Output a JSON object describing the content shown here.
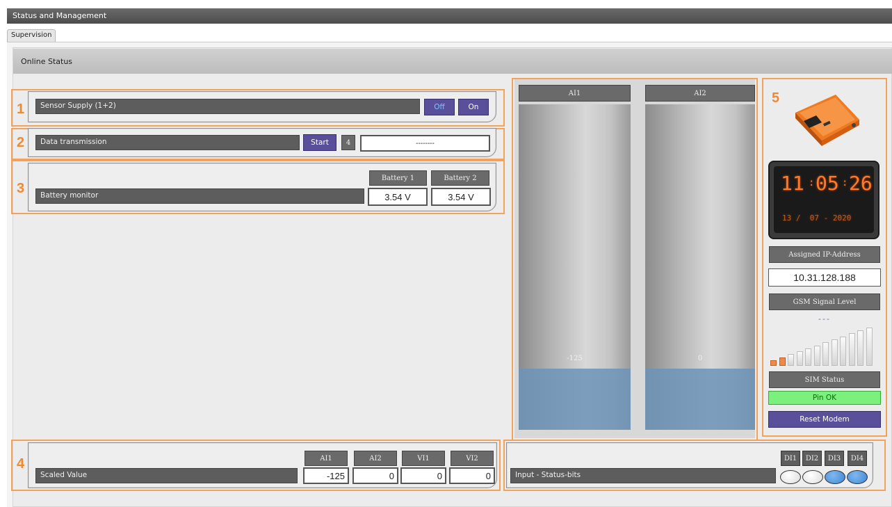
{
  "window": {
    "title": "Status and Management"
  },
  "tabs": [
    {
      "label": "Supervision"
    }
  ],
  "section": {
    "title": "Online Status"
  },
  "sensor_supply": {
    "number": "1",
    "label": "Sensor Supply (1+2)",
    "off_label": "Off",
    "on_label": "On"
  },
  "data_transmission": {
    "number": "2",
    "label": "Data transmission",
    "start_label": "Start",
    "count": "4",
    "value": "--------"
  },
  "battery_monitor": {
    "number": "3",
    "label": "Battery monitor",
    "headers": [
      "Battery 1",
      "Battery 2"
    ],
    "values": [
      "3.54 V",
      "3.54 V"
    ]
  },
  "scaled_value": {
    "number": "4",
    "label": "Scaled Value",
    "headers": [
      "AI1",
      "AI2",
      "VI1",
      "VI2"
    ],
    "values": [
      "-125",
      "0",
      "0",
      "0"
    ]
  },
  "input_status": {
    "label": "Input - Status-bits",
    "headers": [
      "DI1",
      "DI2",
      "DI3",
      "DI4"
    ],
    "states": [
      "off",
      "off",
      "on",
      "on"
    ]
  },
  "gauges": [
    {
      "name": "AI1",
      "value": "-125",
      "fill_fraction": 0.3
    },
    {
      "name": "AI2",
      "value": "0",
      "fill_fraction": 0.3
    }
  ],
  "device": {
    "number": "5",
    "clock": {
      "hh": "11",
      "mm": "05",
      "ss": "26",
      "date": "13 /  07 - 2020"
    },
    "ip_label": "Assigned IP-Address",
    "ip_value": "10.31.128.188",
    "gsm_label": "GSM Signal Level",
    "gsm_value": "---",
    "signal_level": 2,
    "signal_max": 12,
    "sim_label": "SIM Status",
    "sim_value": "Pin OK",
    "reset_label": "Reset Modem"
  },
  "colors": {
    "accent_orange": "#f4a15a",
    "button_purple": "#5a4f9a",
    "ok_green": "#7cf07c",
    "led_on": "#3f86d4",
    "signal_on": "#f08a4a"
  }
}
